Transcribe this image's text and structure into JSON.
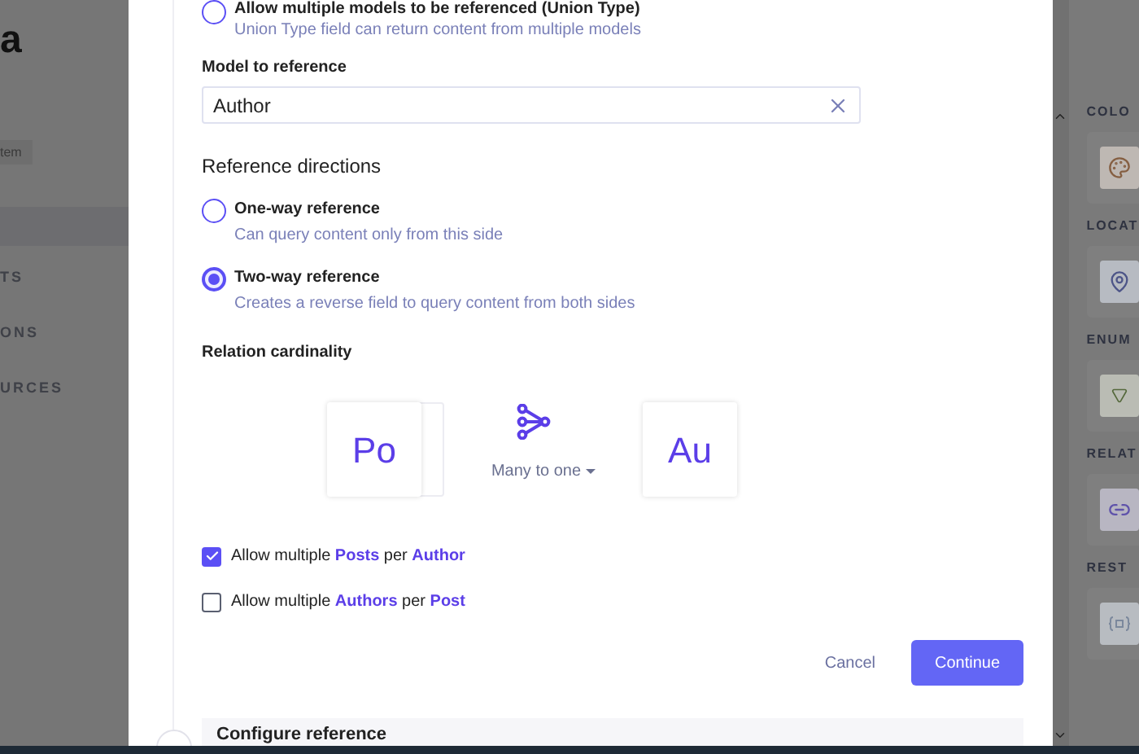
{
  "sidebar": {
    "title": "a",
    "badge": "tem",
    "items": [
      {
        "label": "TS"
      },
      {
        "label": "ONS"
      },
      {
        "label": "URCES"
      }
    ]
  },
  "union_option": {
    "label": "Allow multiple models to be referenced (Union Type)",
    "description": "Union Type field can return content from multiple models",
    "selected": false
  },
  "model_field": {
    "label": "Model to reference",
    "value": "Author"
  },
  "directions": {
    "title": "Reference directions",
    "options": [
      {
        "label": "One-way reference",
        "description": "Can query content only from this side",
        "selected": false
      },
      {
        "label": "Two-way reference",
        "description": "Creates a reverse field to query content from both sides",
        "selected": true
      }
    ]
  },
  "cardinality": {
    "title": "Relation cardinality",
    "source": "Po",
    "target": "Au",
    "relation": "Many to one"
  },
  "checkboxes": [
    {
      "checked": true,
      "parts": [
        {
          "text": "Allow multiple ",
          "highlight": false
        },
        {
          "text": "Posts",
          "highlight": true
        },
        {
          "text": " per ",
          "highlight": false
        },
        {
          "text": "Author",
          "highlight": true
        }
      ]
    },
    {
      "checked": false,
      "parts": [
        {
          "text": "Allow multiple ",
          "highlight": false
        },
        {
          "text": "Authors",
          "highlight": true
        },
        {
          "text": " per ",
          "highlight": false
        },
        {
          "text": "Post",
          "highlight": true
        }
      ]
    }
  ],
  "buttons": {
    "cancel": "Cancel",
    "continue": "Continue"
  },
  "next_step": {
    "title": "Configure reference"
  },
  "right_panel": [
    {
      "title": "COLO",
      "kind": "color"
    },
    {
      "title": "LOCAT",
      "kind": "location"
    },
    {
      "title": "ENUM",
      "kind": "enum"
    },
    {
      "title": "RELAT",
      "kind": "relation"
    },
    {
      "title": "REST",
      "kind": "rest"
    }
  ]
}
